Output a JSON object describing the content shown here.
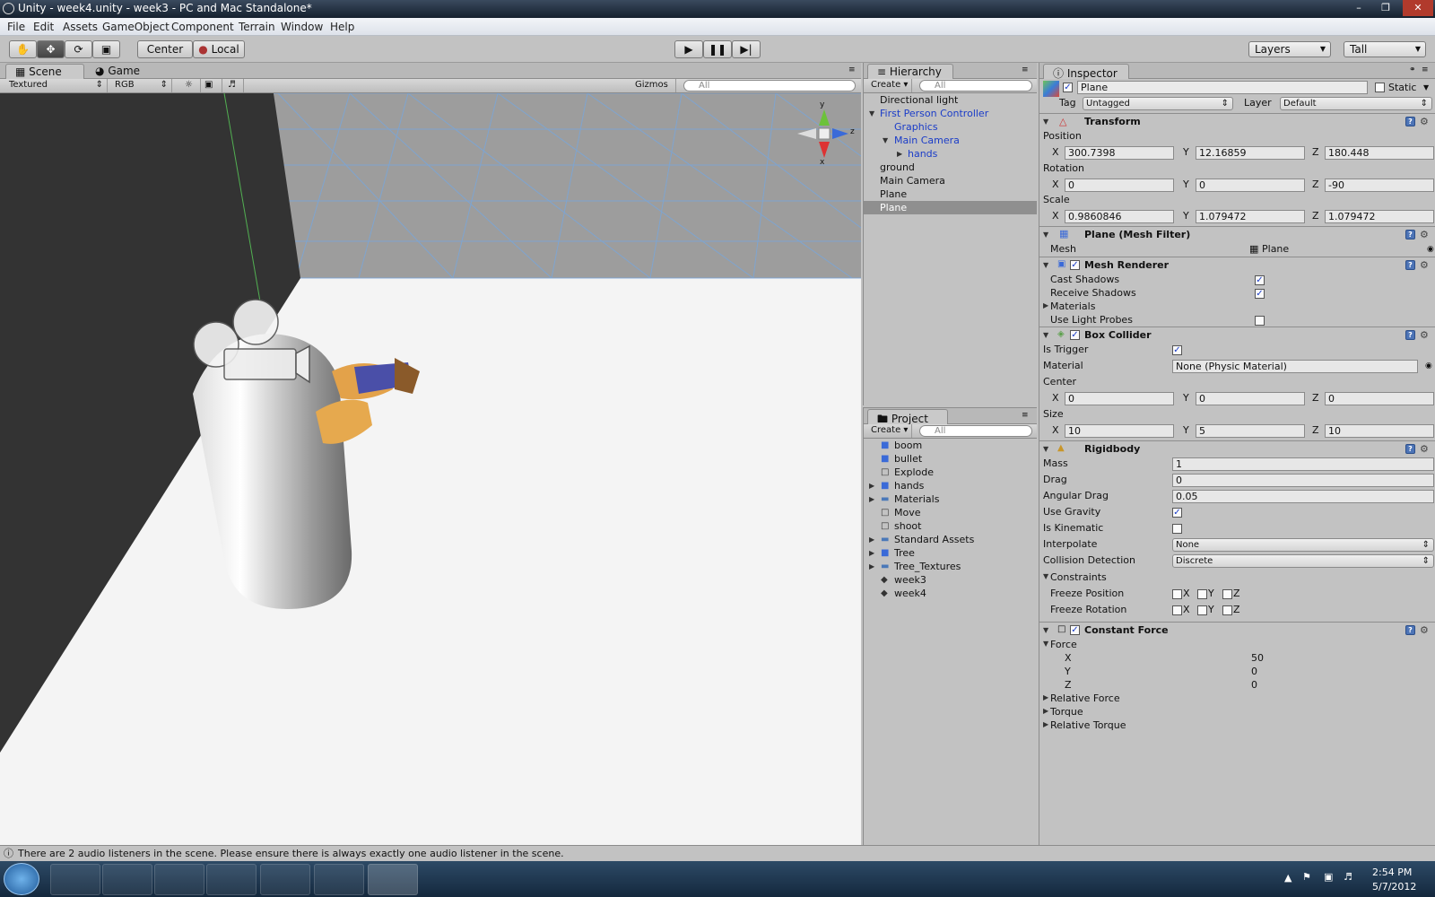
{
  "window": {
    "title": "Unity - week4.unity - week3 - PC and Mac Standalone*"
  },
  "menu": [
    "File",
    "Edit",
    "Assets",
    "GameObject",
    "Component",
    "Terrain",
    "Window",
    "Help"
  ],
  "toolbar": {
    "pivot": "Center",
    "space": "Local",
    "layers": "Layers",
    "layout": "Tall"
  },
  "scene": {
    "tabs": [
      "Scene",
      "Game"
    ],
    "render_mode": "Textured",
    "color_mode": "RGB",
    "gizmos": "Gizmos",
    "search": "All",
    "axis_y": "y",
    "axis_z": "z",
    "axis_x": "x"
  },
  "hierarchy": {
    "tab": "Hierarchy",
    "create": "Create",
    "search": "All",
    "items": [
      "Directional light",
      "First Person Controller",
      "Graphics",
      "Main Camera",
      "hands",
      "ground",
      "Main Camera",
      "Plane",
      "Plane"
    ]
  },
  "project": {
    "tab": "Project",
    "create": "Create",
    "search": "All",
    "items": [
      "boom",
      "bullet",
      "Explode",
      "hands",
      "Materials",
      "Move",
      "shoot",
      "Standard Assets",
      "Tree",
      "Tree_Textures",
      "week3",
      "week4"
    ]
  },
  "inspector": {
    "tab": "Inspector",
    "object_name": "Plane",
    "static_label": "Static",
    "tag_label": "Tag",
    "tag_value": "Untagged",
    "layer_label": "Layer",
    "layer_value": "Default",
    "transform": {
      "title": "Transform",
      "position_label": "Position",
      "rotation_label": "Rotation",
      "scale_label": "Scale",
      "position": {
        "x": "300.7398",
        "y": "12.16859",
        "z": "180.448"
      },
      "rotation": {
        "x": "0",
        "y": "0",
        "z": "-90"
      },
      "scale": {
        "x": "0.9860846",
        "y": "1.079472",
        "z": "1.079472"
      }
    },
    "mesh_filter": {
      "title": "Plane (Mesh Filter)",
      "mesh_label": "Mesh",
      "mesh_value": "Plane"
    },
    "mesh_renderer": {
      "title": "Mesh Renderer",
      "cast_shadows": "Cast Shadows",
      "receive_shadows": "Receive Shadows",
      "materials": "Materials",
      "light_probes": "Use Light Probes"
    },
    "box_collider": {
      "title": "Box Collider",
      "is_trigger": "Is Trigger",
      "material_label": "Material",
      "material_value": "None (Physic Material)",
      "center_label": "Center",
      "size_label": "Size",
      "center": {
        "x": "0",
        "y": "0",
        "z": "0"
      },
      "size": {
        "x": "10",
        "y": "5",
        "z": "10"
      }
    },
    "rigidbody": {
      "title": "Rigidbody",
      "mass_label": "Mass",
      "mass": "1",
      "drag_label": "Drag",
      "drag": "0",
      "angular_drag_label": "Angular Drag",
      "angular_drag": "0.05",
      "use_gravity": "Use Gravity",
      "is_kinematic": "Is Kinematic",
      "interpolate_label": "Interpolate",
      "interpolate": "None",
      "collision_label": "Collision Detection",
      "collision": "Discrete",
      "constraints": "Constraints",
      "freeze_position": "Freeze Position",
      "freeze_rotation": "Freeze Rotation"
    },
    "constant_force": {
      "title": "Constant Force",
      "force_label": "Force",
      "x": "50",
      "y": "0",
      "z": "0",
      "relative_force": "Relative Force",
      "torque": "Torque",
      "relative_torque": "Relative Torque"
    },
    "axis": {
      "x": "X",
      "y": "Y",
      "z": "Z"
    }
  },
  "status": "There are 2 audio listeners in the scene. Please ensure there is always exactly one audio listener in the scene.",
  "clock": {
    "time": "2:54 PM",
    "date": "5/7/2012"
  }
}
